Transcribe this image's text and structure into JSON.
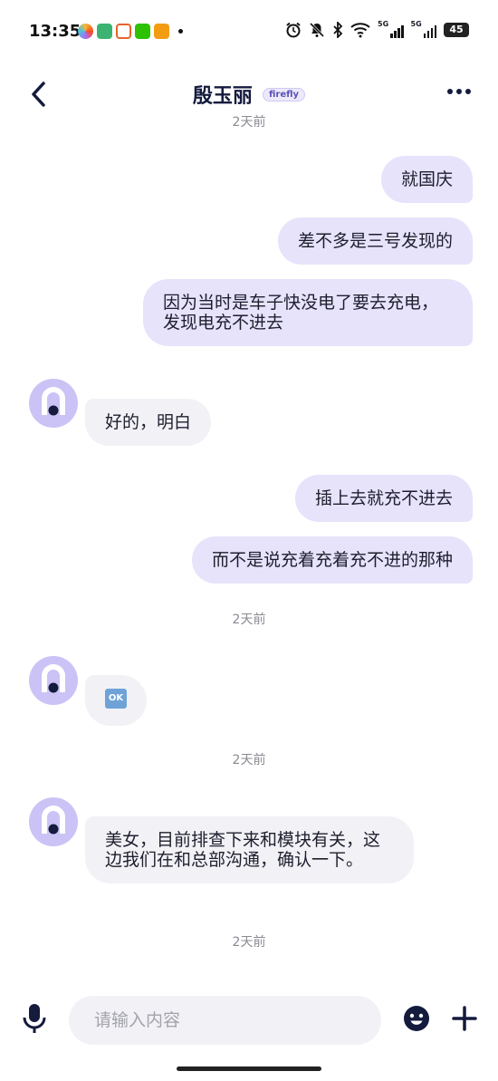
{
  "status_bar": {
    "time": "13:35",
    "signal1_label": "5G",
    "signal2_label": "5G",
    "battery": "45"
  },
  "header": {
    "title": "殷玉丽",
    "badge": "firefly"
  },
  "messages": [
    {
      "type": "timestamp",
      "text": "2天前"
    },
    {
      "type": "outgoing",
      "text": "就国庆"
    },
    {
      "type": "outgoing",
      "text": "差不多是三号发现的"
    },
    {
      "type": "outgoing",
      "text": "因为当时是车子快没电了要去充电，发现电充不进去"
    },
    {
      "type": "incoming",
      "text": "好的，明白"
    },
    {
      "type": "outgoing",
      "text": "插上去就充不进去"
    },
    {
      "type": "outgoing",
      "text": "而不是说充着充着充不进的那种"
    },
    {
      "type": "timestamp",
      "text": "2天前"
    },
    {
      "type": "incoming",
      "text": "🆗"
    },
    {
      "type": "timestamp",
      "text": "2天前"
    },
    {
      "type": "incoming",
      "text": "美女，目前排查下来和模块有关，这边我们在和总部沟通，确认一下。"
    },
    {
      "type": "timestamp",
      "text": "2天前"
    }
  ],
  "input": {
    "placeholder": "请输入内容"
  },
  "colors": {
    "outgoing_bubble": "#e6e3fb",
    "incoming_bubble": "#f2f2f6",
    "accent": "#141b3d",
    "avatar": "#cbc3f5"
  }
}
